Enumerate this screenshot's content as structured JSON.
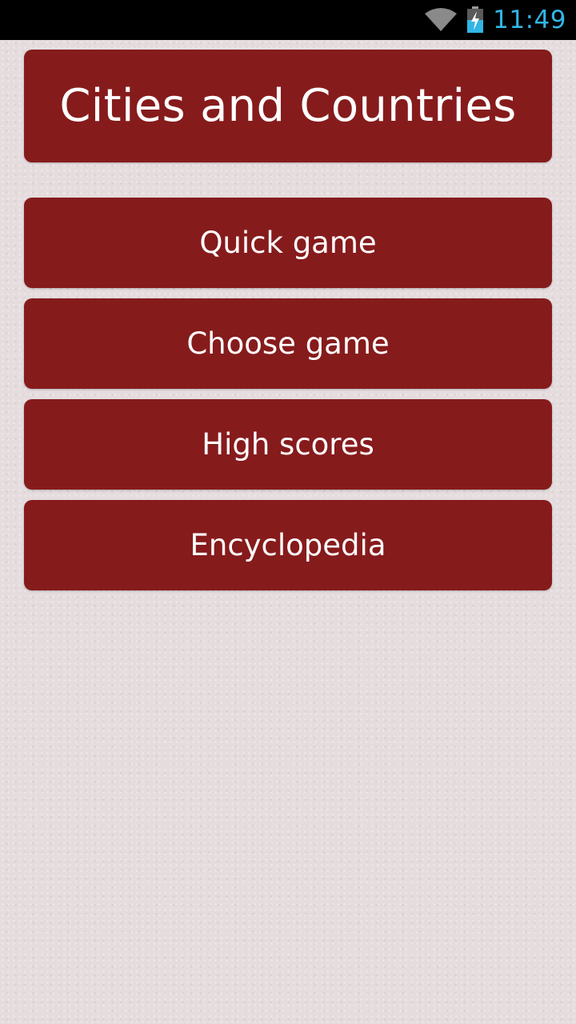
{
  "status_bar": {
    "time": "11:49",
    "icons": [
      "wifi-icon",
      "battery-charging-icon"
    ],
    "clock_color": "#33b5e5"
  },
  "app": {
    "title": "Cities and Countries",
    "accent_color": "#861b1c"
  },
  "menu": {
    "items": [
      {
        "label": "Quick game"
      },
      {
        "label": "Choose game"
      },
      {
        "label": "High scores"
      },
      {
        "label": "Encyclopedia"
      }
    ]
  }
}
